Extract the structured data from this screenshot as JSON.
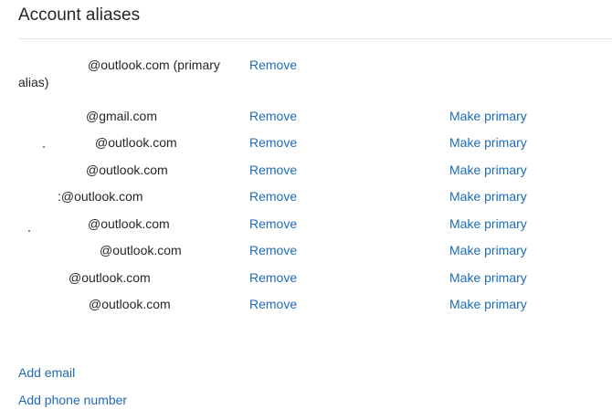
{
  "page": {
    "title": "Account aliases"
  },
  "primary_alias": {
    "email_line1": "@outlook.com (primary",
    "email_line2": "alias)",
    "remove_label": "Remove"
  },
  "aliases": [
    {
      "email": "@gmail.com",
      "remove_label": "Remove",
      "make_primary_label": "Make primary"
    },
    {
      "email": "@outlook.com",
      "remove_label": "Remove",
      "make_primary_label": "Make primary"
    },
    {
      "email": "@outlook.com",
      "remove_label": "Remove",
      "make_primary_label": "Make primary"
    },
    {
      "email": ":@outlook.com",
      "remove_label": "Remove",
      "make_primary_label": "Make primary"
    },
    {
      "email": "@outlook.com",
      "remove_label": "Remove",
      "make_primary_label": "Make primary"
    },
    {
      "email": "@outlook.com",
      "remove_label": "Remove",
      "make_primary_label": "Make primary"
    },
    {
      "email": "@outlook.com",
      "remove_label": "Remove",
      "make_primary_label": "Make primary"
    },
    {
      "email": "@outlook.com",
      "remove_label": "Remove",
      "make_primary_label": "Make primary"
    }
  ],
  "footer": {
    "add_email_label": "Add email",
    "add_phone_label": "Add phone number"
  },
  "colors": {
    "link": "#1f6bb5",
    "text": "#262626",
    "divider": "#e3e3e3"
  }
}
